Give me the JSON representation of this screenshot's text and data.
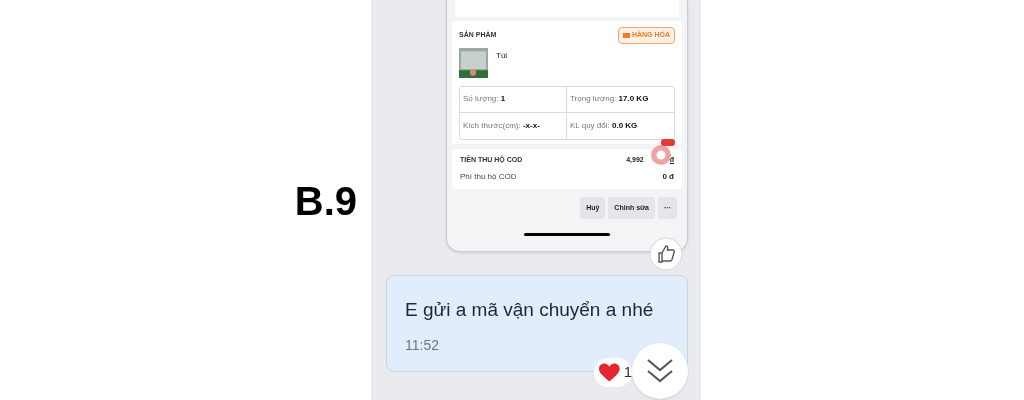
{
  "label": "B.9",
  "screenshot": {
    "product": {
      "title": "SẢN PHẨM",
      "badge": "HÀNG HÓA",
      "name": "Túi",
      "fields": [
        {
          "label": "Số lượng:",
          "value": "1"
        },
        {
          "label": "Trọng lượng:",
          "value": "17.0 KG"
        },
        {
          "label": "Kích thước(cm):",
          "value": "-x-x-"
        },
        {
          "label": "KL quy đổi:",
          "value": "0.0 KG"
        }
      ]
    },
    "cod": [
      {
        "label": "TIỀN THU HỘ COD",
        "value": "4,992",
        "currency": "đ"
      },
      {
        "label": "Phí thu hộ COD",
        "value": "0 đ"
      }
    ],
    "actions": [
      "Huỷ",
      "Chỉnh sửa",
      "···"
    ]
  },
  "message": {
    "text": "E gửi a mã vận chuyển a nhé",
    "time": "11:52",
    "reaction_count": "1"
  }
}
